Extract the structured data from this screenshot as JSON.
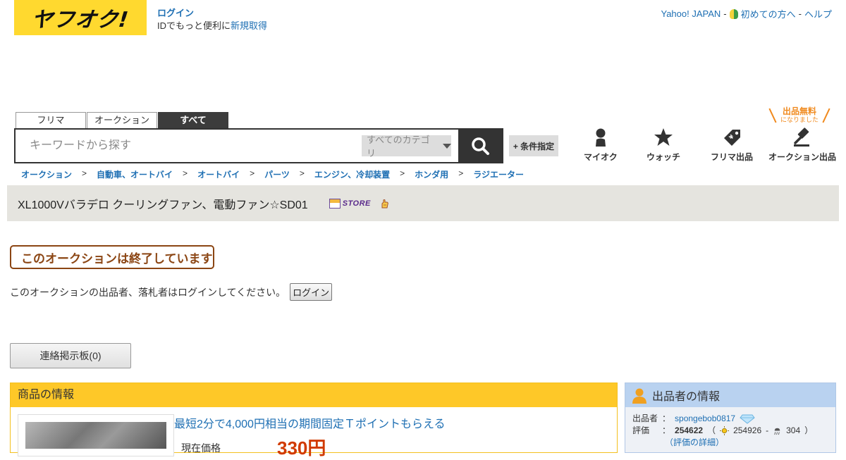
{
  "header": {
    "logo_text": "ヤフオク!",
    "login_label": "ログイン",
    "id_text": "IDでもっと便利に",
    "register_label": "新規取得",
    "yahoo_japan": "Yahoo! JAPAN",
    "sep1": "-",
    "beginner_label": "初めての方へ",
    "sep2": "-",
    "help_label": "ヘルプ"
  },
  "search": {
    "tabs": [
      {
        "label": "フリマ"
      },
      {
        "label": "オークション"
      },
      {
        "label": "すべて"
      }
    ],
    "placeholder": "キーワードから探す",
    "category": "すべてのカテゴリ",
    "condition_label": "+ 条件指定"
  },
  "free_badge": {
    "line1": "出品無料",
    "line2": "になりました"
  },
  "nav": {
    "my_auction": "マイオク",
    "watch": "ウォッチ",
    "flea_listing": "フリマ出品",
    "auction_listing": "オークション出品"
  },
  "breadcrumb": [
    "オークション",
    "自動車、オートバイ",
    "オートバイ",
    "パーツ",
    "エンジン、冷却装置",
    "ホンダ用",
    "ラジエーター"
  ],
  "breadcrumb_sep": ">",
  "title": "XL1000Vバラデロ クーリングファン、電動ファン☆SD01",
  "store_badge": "STORE",
  "ended_text": "このオークションは終了しています",
  "login_note": "このオークションの出品者、落札者はログインしてください。",
  "login_button": "ログイン",
  "board_button": "連絡掲示板(0)",
  "item_panel": {
    "heading": "商品の情報",
    "promo": "最短2分で4,000円相当の期間固定Ｔポイントもらえる",
    "price_label": "現在価格",
    "price": "330円"
  },
  "seller_panel": {
    "heading": "出品者の情報",
    "seller_key": "出品者",
    "seller_colon": "：",
    "seller_name": "spongebob0817",
    "rating_key": "評価",
    "rating_colon": "：",
    "rating_total": "254622",
    "rating_good": "254926",
    "rating_dash": "-",
    "rating_bad": "304",
    "rating_open": "（",
    "rating_close": "）",
    "rating_detail": "（評価の詳細）"
  },
  "colors": {
    "logo_yellow": "#ffd92f",
    "link_blue": "#1e6fb3",
    "item_head": "#fec828",
    "seller_head": "#b9d2f0",
    "ended_brown": "#8b4513",
    "price_red": "#d13a00"
  }
}
